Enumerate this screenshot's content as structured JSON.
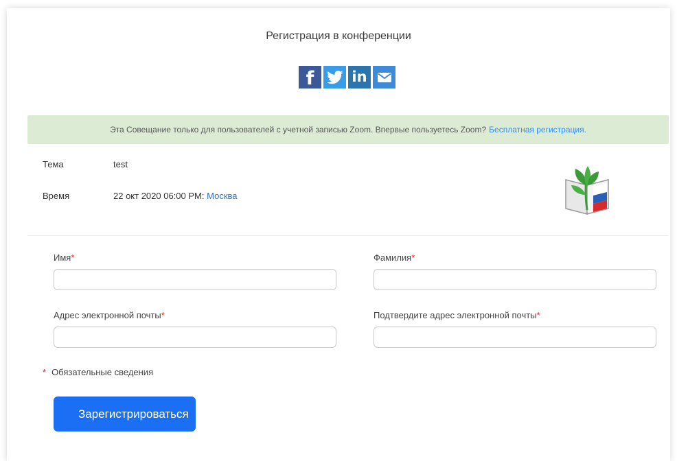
{
  "page": {
    "title": "Регистрация в конференции"
  },
  "share": {
    "buttons": [
      {
        "network": "facebook",
        "glyph": "f",
        "icon": "facebook-icon",
        "color": "#3b5998"
      },
      {
        "network": "twitter",
        "icon": "twitter-icon",
        "color": "#3a9be6"
      },
      {
        "network": "linkedin",
        "glyph": "in",
        "icon": "linkedin-icon",
        "color": "#2b74ad"
      },
      {
        "network": "email",
        "icon": "email-icon",
        "color": "#3d8bd8"
      }
    ]
  },
  "notice": {
    "text": "Эта Совещание только для пользователей с учетной записью Zoom. Впервые пользуетесь Zoom?",
    "link": "Бесплатная регистрация.",
    "background": "#dcecd4"
  },
  "meeting": {
    "topic_label": "Тема",
    "topic_value": "test",
    "time_label": "Время",
    "time_value": "22 окт 2020 06:00 PM:",
    "timezone": "Москва"
  },
  "form": {
    "first_name_label": "Имя",
    "last_name_label": "Фамилия",
    "email_label": "Адрес электронной почты",
    "confirm_email_label": "Подтвердите адрес электронной почты",
    "required_marker": "*",
    "first_name_value": "",
    "last_name_value": "",
    "email_value": "",
    "confirm_email_value": "",
    "required_note": "Обязательные сведения",
    "submit_label": "Зарегистрироваться"
  },
  "colors": {
    "accent": "#1b6ff5",
    "link": "#2d8cff",
    "required": "#e02828"
  }
}
